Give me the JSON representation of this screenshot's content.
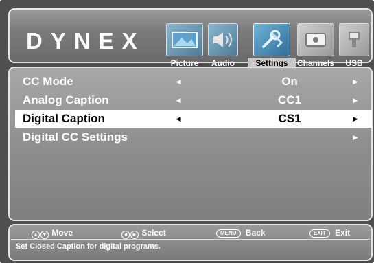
{
  "brand": "DYNEX",
  "tabs": [
    {
      "label": "Picture",
      "icon": "picture-icon",
      "selected": false
    },
    {
      "label": "Audio",
      "icon": "audio-icon",
      "selected": false
    },
    {
      "label": "Settings",
      "icon": "settings-icon",
      "selected": true
    },
    {
      "label": "Channels",
      "icon": "channels-icon",
      "selected": false
    },
    {
      "label": "USB",
      "icon": "usb-icon",
      "selected": false
    }
  ],
  "menu": {
    "rows": [
      {
        "name": "CC Mode",
        "left_arrow": "◄",
        "value": "On",
        "right_arrow": "►",
        "selected": false
      },
      {
        "name": "Analog Caption",
        "left_arrow": "◄",
        "value": "CC1",
        "right_arrow": "►",
        "selected": false
      },
      {
        "name": "Digital Caption",
        "left_arrow": "◄",
        "value": "CS1",
        "right_arrow": "►",
        "selected": true
      },
      {
        "name": "Digital CC Settings",
        "left_arrow": "",
        "value": "",
        "right_arrow": "►",
        "selected": false
      }
    ]
  },
  "footer": {
    "move_keys": "▲▼",
    "move_label": "Move",
    "select_keys": "◄►",
    "select_label": "Select",
    "back_key": "MENU",
    "back_label": "Back",
    "exit_key": "EXIT",
    "exit_label": "Exit",
    "status": "Set Closed Caption for digital programs."
  },
  "colors": {
    "background": "#4f4f4f",
    "panel": "#8c8c8c",
    "selected_row": "#ffffff",
    "text": "#ffffff"
  }
}
